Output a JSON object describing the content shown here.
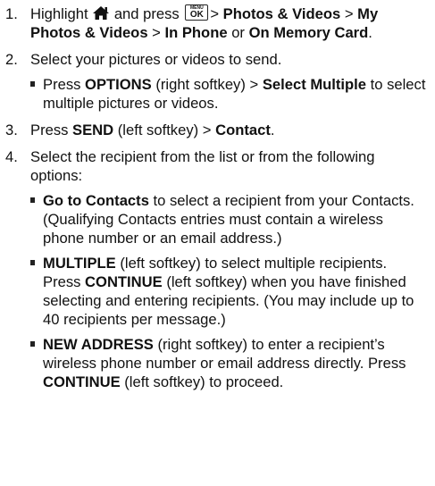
{
  "steps": [
    {
      "num": "1.",
      "highlight": "Highlight",
      "and_press": "and press",
      "key_top": "MENU",
      "key_main": "OK",
      "gt1": ">",
      "photos_videos": "Photos & Videos",
      "gt2": ">",
      "my_photos_videos": "My Photos & Videos",
      "gt3": ">",
      "in_phone": "In Phone",
      "or": "or",
      "on_memory_card": "On Memory Card",
      "period": "."
    },
    {
      "num": "2.",
      "text": "Select your pictures or videos to send.",
      "sub": {
        "press": "Press",
        "options": "OPTIONS",
        "right_softkey": "(right softkey)",
        "gt": ">",
        "select_multiple": "Select Multiple",
        "rest": "to select multiple pictures or videos."
      }
    },
    {
      "num": "3.",
      "press": "Press",
      "send": "SEND",
      "left_softkey": "(left softkey)",
      "gt": ">",
      "contact": "Contact",
      "period": "."
    },
    {
      "num": "4.",
      "text": "Select the recipient from the list or from the following options:",
      "subs": [
        {
          "bold": "Go to Contacts",
          "rest": "to select a recipient from your Contacts. (Qualifying Contacts entries must contain a wireless phone number or an email address.)"
        },
        {
          "bold": "MULTIPLE",
          "rest1": "(left softkey) to select multiple recipients. Press",
          "bold2": "CONTINUE",
          "rest2": "(left softkey) when you have finished selecting and entering recipients. (You may include up to 40 recipients per message.)"
        },
        {
          "bold": "NEW ADDRESS",
          "rest1": "(right softkey) to enter a recipient’s wireless phone number or email address directly. Press",
          "bold2": "CONTINUE",
          "rest2": "(left softkey) to proceed."
        }
      ]
    }
  ],
  "icons": {
    "home": "home-icon",
    "menu_ok_key": "menu-ok-key-icon",
    "bullet": "square-bullet"
  }
}
